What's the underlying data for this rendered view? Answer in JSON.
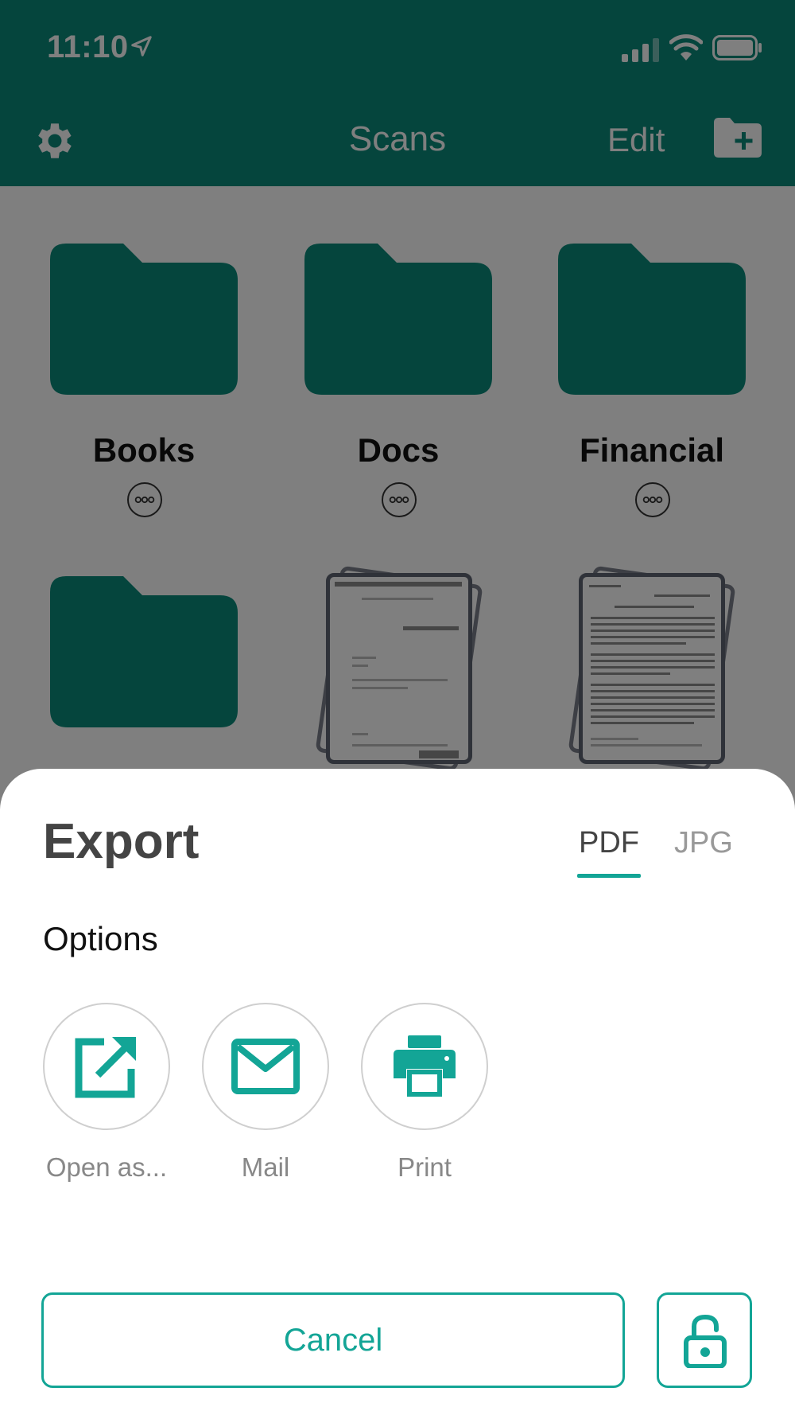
{
  "status_bar": {
    "time": "11:10"
  },
  "nav": {
    "title": "Scans",
    "edit_label": "Edit",
    "gear_icon": "gear-icon",
    "new_folder_icon": "folder-plus-icon"
  },
  "folders": [
    {
      "name": "Books"
    },
    {
      "name": "Docs"
    },
    {
      "name": "Financial"
    }
  ],
  "export_sheet": {
    "title": "Export",
    "tabs": [
      {
        "label": "PDF",
        "selected": true
      },
      {
        "label": "JPG",
        "selected": false
      }
    ],
    "options_label": "Options",
    "options": [
      {
        "label": "Open as...",
        "icon": "open-external-icon"
      },
      {
        "label": "Mail",
        "icon": "mail-icon"
      },
      {
        "label": "Print",
        "icon": "printer-icon"
      }
    ],
    "cancel_label": "Cancel",
    "lock_icon": "unlock-icon"
  },
  "colors": {
    "brand": "#0b8a7a",
    "accent": "#13a596"
  }
}
